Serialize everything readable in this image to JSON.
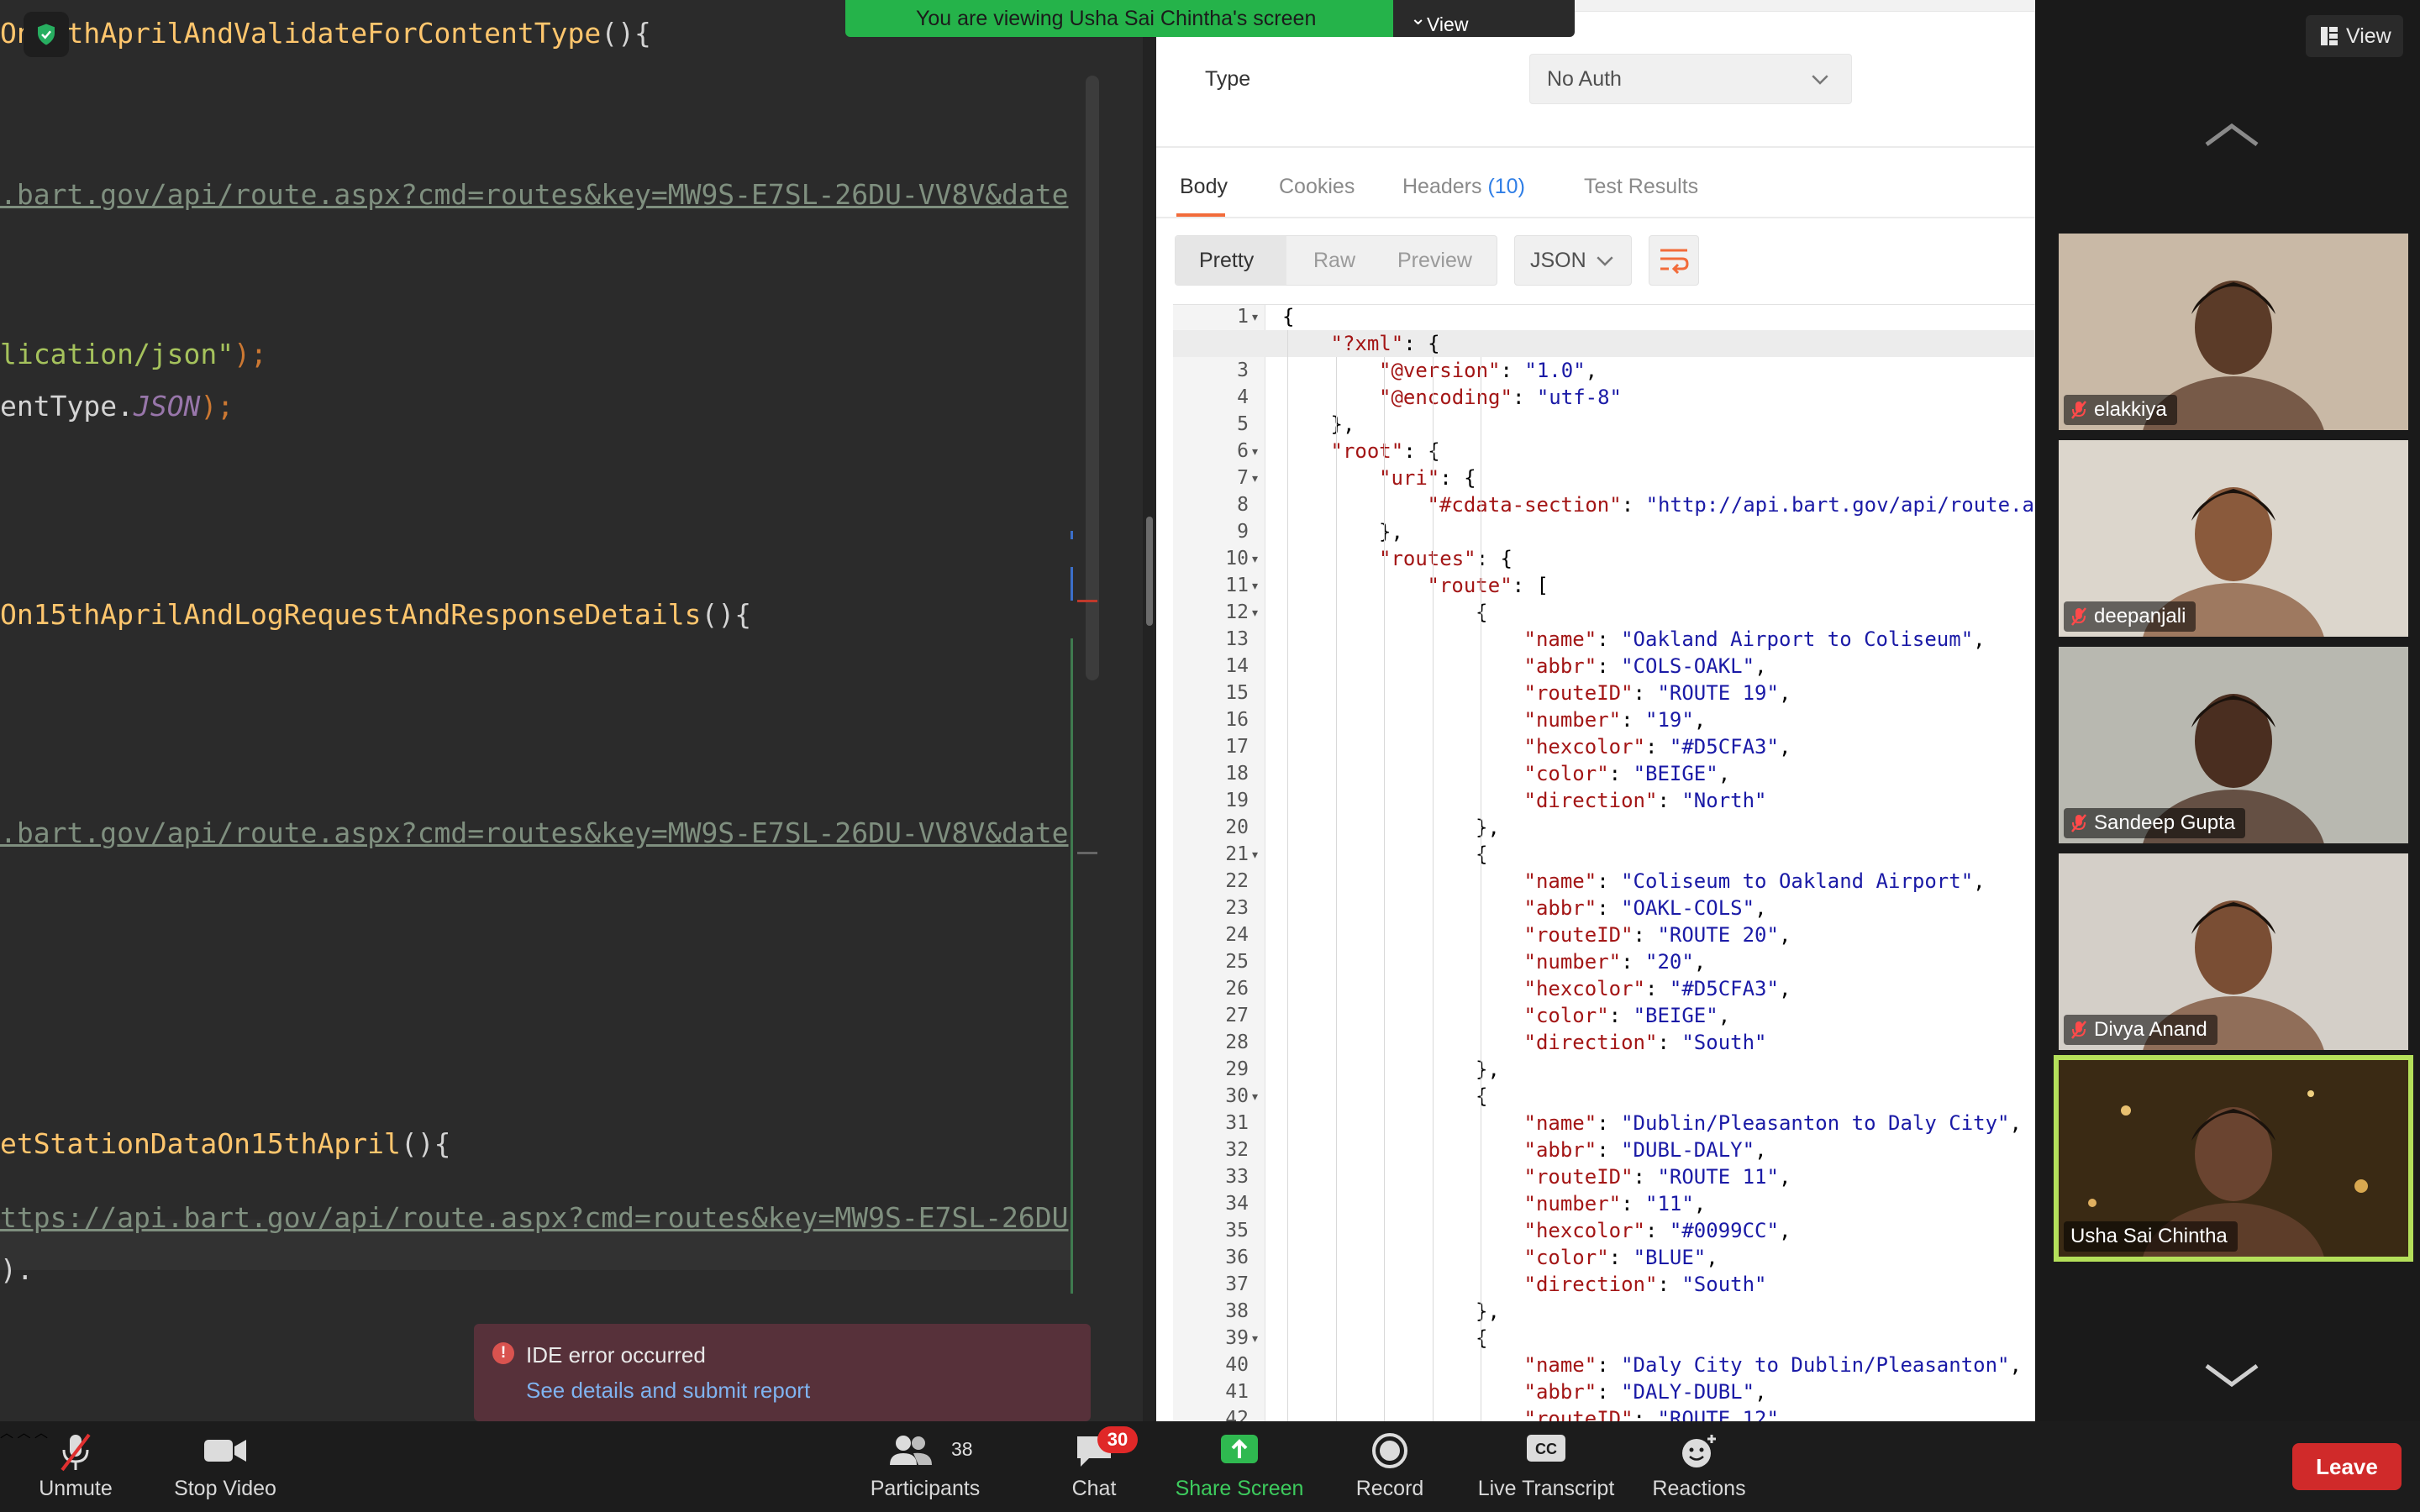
{
  "share_banner": {
    "text": "You are viewing Usha Sai Chintha's screen",
    "options_label": "View Options"
  },
  "view_button": {
    "label": "View"
  },
  "ide": {
    "lines": [
      {
        "fn": "On15thAprilAndValidateForContentType",
        "tail": "(){"
      },
      {
        "url": ".bart.gov/api/route.aspx?cmd=routes&key=MW9S-E7SL-26DU-VV8V&date"
      },
      {
        "str": "lication/json\"",
        "tail": ");"
      },
      {
        "plain": "entType.",
        "const": "JSON",
        "tail": ");"
      },
      {
        "fn": "On15thAprilAndLogRequestAndResponseDetails",
        "tail": "(){"
      },
      {
        "url": ".bart.gov/api/route.aspx?cmd=routes&key=MW9S-E7SL-26DU-VV8V&date"
      },
      {
        "fn": "etStationDataOn15thApril",
        "tail": "(){"
      },
      {
        "url": "ttps://api.bart.gov/api/route.aspx?cmd=routes&key=MW9S-E7SL-26DU"
      },
      {
        "plain": ")."
      }
    ],
    "error_popup": {
      "title": "IDE error occurred",
      "link": "See details and submit report"
    }
  },
  "postman": {
    "auth_type_label": "Type",
    "auth_type_value": "No Auth",
    "tabs": [
      {
        "label": "Body"
      },
      {
        "label": "Cookies"
      },
      {
        "label": "Headers",
        "count": "(10)"
      },
      {
        "label": "Test Results"
      }
    ],
    "view_modes": [
      "Pretty",
      "Raw",
      "Preview"
    ],
    "format": "JSON",
    "json_lines": [
      {
        "n": "1",
        "fold": true,
        "indent": 0,
        "text": "{"
      },
      {
        "n": "2",
        "fold": true,
        "indent": 1,
        "key": "\"?xml\"",
        "rest": ": {"
      },
      {
        "n": "3",
        "indent": 2,
        "key": "\"@version\"",
        "rest": ": ",
        "val": "\"1.0\"",
        "end": ","
      },
      {
        "n": "4",
        "indent": 2,
        "key": "\"@encoding\"",
        "rest": ": ",
        "val": "\"utf-8\""
      },
      {
        "n": "5",
        "indent": 1,
        "text": "},"
      },
      {
        "n": "6",
        "fold": true,
        "indent": 1,
        "key": "\"root\"",
        "rest": ": {"
      },
      {
        "n": "7",
        "fold": true,
        "indent": 2,
        "key": "\"uri\"",
        "rest": ": {"
      },
      {
        "n": "8",
        "indent": 3,
        "key": "\"#cdata-section\"",
        "rest": ": ",
        "val": "\"http://api.bart.gov/api/route.as"
      },
      {
        "n": "9",
        "indent": 2,
        "text": "},"
      },
      {
        "n": "10",
        "fold": true,
        "indent": 2,
        "key": "\"routes\"",
        "rest": ": {"
      },
      {
        "n": "11",
        "fold": true,
        "indent": 3,
        "key": "\"route\"",
        "rest": ": ["
      },
      {
        "n": "12",
        "fold": true,
        "indent": 4,
        "text": "{"
      },
      {
        "n": "13",
        "indent": 5,
        "key": "\"name\"",
        "rest": ": ",
        "val": "\"Oakland Airport to Coliseum\"",
        "end": ","
      },
      {
        "n": "14",
        "indent": 5,
        "key": "\"abbr\"",
        "rest": ": ",
        "val": "\"COLS-OAKL\"",
        "end": ","
      },
      {
        "n": "15",
        "indent": 5,
        "key": "\"routeID\"",
        "rest": ": ",
        "val": "\"ROUTE 19\"",
        "end": ","
      },
      {
        "n": "16",
        "indent": 5,
        "key": "\"number\"",
        "rest": ": ",
        "val": "\"19\"",
        "end": ","
      },
      {
        "n": "17",
        "indent": 5,
        "key": "\"hexcolor\"",
        "rest": ": ",
        "val": "\"#D5CFA3\"",
        "end": ","
      },
      {
        "n": "18",
        "indent": 5,
        "key": "\"color\"",
        "rest": ": ",
        "val": "\"BEIGE\"",
        "end": ","
      },
      {
        "n": "19",
        "indent": 5,
        "key": "\"direction\"",
        "rest": ": ",
        "val": "\"North\""
      },
      {
        "n": "20",
        "indent": 4,
        "text": "},"
      },
      {
        "n": "21",
        "fold": true,
        "indent": 4,
        "text": "{"
      },
      {
        "n": "22",
        "indent": 5,
        "key": "\"name\"",
        "rest": ": ",
        "val": "\"Coliseum to Oakland Airport\"",
        "end": ","
      },
      {
        "n": "23",
        "indent": 5,
        "key": "\"abbr\"",
        "rest": ": ",
        "val": "\"OAKL-COLS\"",
        "end": ","
      },
      {
        "n": "24",
        "indent": 5,
        "key": "\"routeID\"",
        "rest": ": ",
        "val": "\"ROUTE 20\"",
        "end": ","
      },
      {
        "n": "25",
        "indent": 5,
        "key": "\"number\"",
        "rest": ": ",
        "val": "\"20\"",
        "end": ","
      },
      {
        "n": "26",
        "indent": 5,
        "key": "\"hexcolor\"",
        "rest": ": ",
        "val": "\"#D5CFA3\"",
        "end": ","
      },
      {
        "n": "27",
        "indent": 5,
        "key": "\"color\"",
        "rest": ": ",
        "val": "\"BEIGE\"",
        "end": ","
      },
      {
        "n": "28",
        "indent": 5,
        "key": "\"direction\"",
        "rest": ": ",
        "val": "\"South\""
      },
      {
        "n": "29",
        "indent": 4,
        "text": "},"
      },
      {
        "n": "30",
        "fold": true,
        "indent": 4,
        "text": "{"
      },
      {
        "n": "31",
        "indent": 5,
        "key": "\"name\"",
        "rest": ": ",
        "val": "\"Dublin/Pleasanton to Daly City\"",
        "end": ","
      },
      {
        "n": "32",
        "indent": 5,
        "key": "\"abbr\"",
        "rest": ": ",
        "val": "\"DUBL-DALY\"",
        "end": ","
      },
      {
        "n": "33",
        "indent": 5,
        "key": "\"routeID\"",
        "rest": ": ",
        "val": "\"ROUTE 11\"",
        "end": ","
      },
      {
        "n": "34",
        "indent": 5,
        "key": "\"number\"",
        "rest": ": ",
        "val": "\"11\"",
        "end": ","
      },
      {
        "n": "35",
        "indent": 5,
        "key": "\"hexcolor\"",
        "rest": ": ",
        "val": "\"#0099CC\"",
        "end": ","
      },
      {
        "n": "36",
        "indent": 5,
        "key": "\"color\"",
        "rest": ": ",
        "val": "\"BLUE\"",
        "end": ","
      },
      {
        "n": "37",
        "indent": 5,
        "key": "\"direction\"",
        "rest": ": ",
        "val": "\"South\""
      },
      {
        "n": "38",
        "indent": 4,
        "text": "},"
      },
      {
        "n": "39",
        "fold": true,
        "indent": 4,
        "text": "{"
      },
      {
        "n": "40",
        "indent": 5,
        "key": "\"name\"",
        "rest": ": ",
        "val": "\"Daly City to Dublin/Pleasanton\"",
        "end": ","
      },
      {
        "n": "41",
        "indent": 5,
        "key": "\"abbr\"",
        "rest": ": ",
        "val": "\"DALY-DUBL\"",
        "end": ","
      },
      {
        "n": "42",
        "indent": 5,
        "key": "\"routeID\"",
        "rest": ": ",
        "val": "\"ROUTE 12\""
      }
    ]
  },
  "participants_gallery": [
    {
      "name": "elakkiya",
      "muted": true,
      "bg": "#c9b9a6",
      "face": "#5b3b28"
    },
    {
      "name": "deepanjali",
      "muted": true,
      "bg": "#dcd6cc",
      "face": "#8a5a3c"
    },
    {
      "name": "Sandeep Gupta",
      "muted": true,
      "bg": "#b8b8b0",
      "face": "#4a2e20"
    },
    {
      "name": "Divya Anand",
      "muted": true,
      "bg": "#d4cfc8",
      "face": "#7a4e34"
    },
    {
      "name": "Usha Sai Chintha",
      "muted": false,
      "active_speaker": true,
      "bg": "#3a2a14",
      "face": "#6a4430"
    }
  ],
  "toolbar": {
    "unmute": "Unmute",
    "stop_video": "Stop Video",
    "participants": "Participants",
    "participants_count": "38",
    "chat": "Chat",
    "chat_badge": "30",
    "share_screen": "Share Screen",
    "record": "Record",
    "live_transcript": "Live Transcript",
    "reactions": "Reactions",
    "leave": "Leave"
  },
  "colors": {
    "share_green": "#25b34a",
    "leave_red": "#d02a2a",
    "speaker_outline": "#b4e05a",
    "postman_orange": "#f26b3a"
  }
}
